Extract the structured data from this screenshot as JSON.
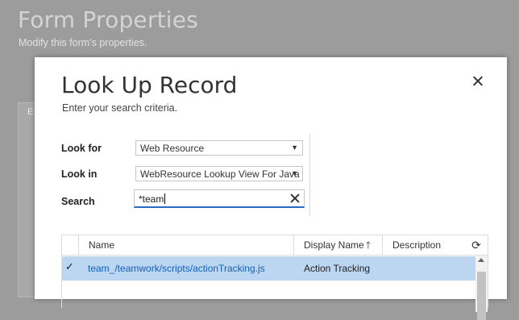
{
  "background": {
    "title": "Form Properties",
    "subtitle": "Modify this form's properties.",
    "panel_letter": "E"
  },
  "dialog": {
    "title": "Look Up Record",
    "subtitle": "Enter your search criteria.",
    "close_icon": "close-icon",
    "look_for": {
      "label": "Look for",
      "value": "Web Resource"
    },
    "look_in": {
      "label": "Look in",
      "value": "WebResource Lookup View For Java"
    },
    "search": {
      "label": "Search",
      "value": "*team"
    },
    "dropdown_icon": "▼",
    "clear_icon": "clear-icon"
  },
  "grid": {
    "columns": {
      "name": "Name",
      "display_name": "Display Name",
      "sort_arrow": "🡑",
      "description": "Description"
    },
    "refresh_icon": "⟳",
    "rows": [
      {
        "selected": true,
        "check": "✓",
        "name": "team_/teamwork/scripts/actionTracking.js",
        "display_name": "Action Tracking",
        "description": ""
      }
    ]
  },
  "colors": {
    "selection": "#bcd6f2",
    "link": "#1160b7",
    "focus_border": "#2a6bc6"
  }
}
